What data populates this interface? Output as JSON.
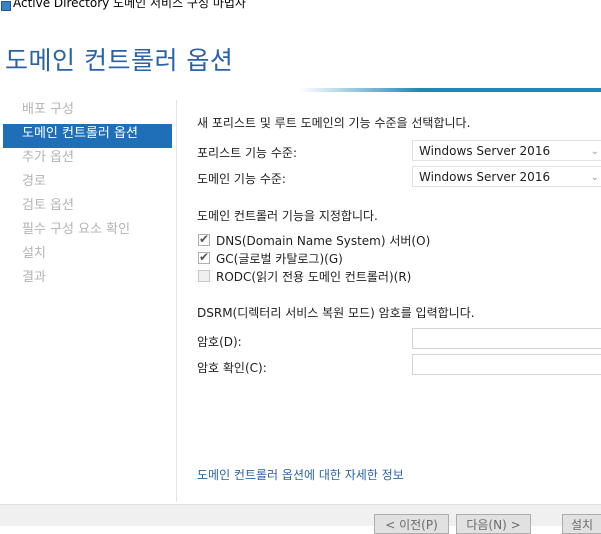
{
  "window": {
    "title": "Active Directory 도메인 서비스 구성 마법사"
  },
  "page": {
    "title": "도메인 컨트롤러 옵션"
  },
  "nav": {
    "items": [
      {
        "label": "배포 구성",
        "active": false
      },
      {
        "label": "도메인 컨트롤러 옵션",
        "active": true
      },
      {
        "label": "추가 옵션",
        "active": false
      },
      {
        "label": "경로",
        "active": false
      },
      {
        "label": "검토 옵션",
        "active": false
      },
      {
        "label": "필수 구성 요소 확인",
        "active": false
      },
      {
        "label": "설치",
        "active": false
      },
      {
        "label": "결과",
        "active": false
      }
    ]
  },
  "content": {
    "level_heading": "새 포리스트 및 루트 도메인의 기능 수준을 선택합니다.",
    "forest_level_label": "포리스트 기능 수준:",
    "forest_level_value": "Windows Server 2016",
    "domain_level_label": "도메인 기능 수준:",
    "domain_level_value": "Windows Server 2016",
    "capabilities_heading": "도메인 컨트롤러 기능을 지정합니다.",
    "checkboxes": [
      {
        "label": "DNS(Domain Name System) 서버(O)",
        "checked": true,
        "enabled": true
      },
      {
        "label": "GC(글로벌 카탈로그)(G)",
        "checked": true,
        "enabled": true
      },
      {
        "label": "RODC(읽기 전용 도메인 컨트롤러)(R)",
        "checked": false,
        "enabled": false
      }
    ],
    "dsrm_heading": "DSRM(디렉터리 서비스 복원 모드) 암호를 입력합니다.",
    "password_label": "암호(D):",
    "confirm_label": "암호 확인(C):",
    "more_link": "도메인 컨트롤러 옵션에 대한 자세한 정보"
  },
  "footer": {
    "prev_label": "< 이전(P)",
    "next_label": "다음(N) >",
    "install_label": "설치"
  },
  "colors": {
    "accent": "#1e6fb8",
    "title": "#2a62a8",
    "link": "#2b64aa"
  }
}
